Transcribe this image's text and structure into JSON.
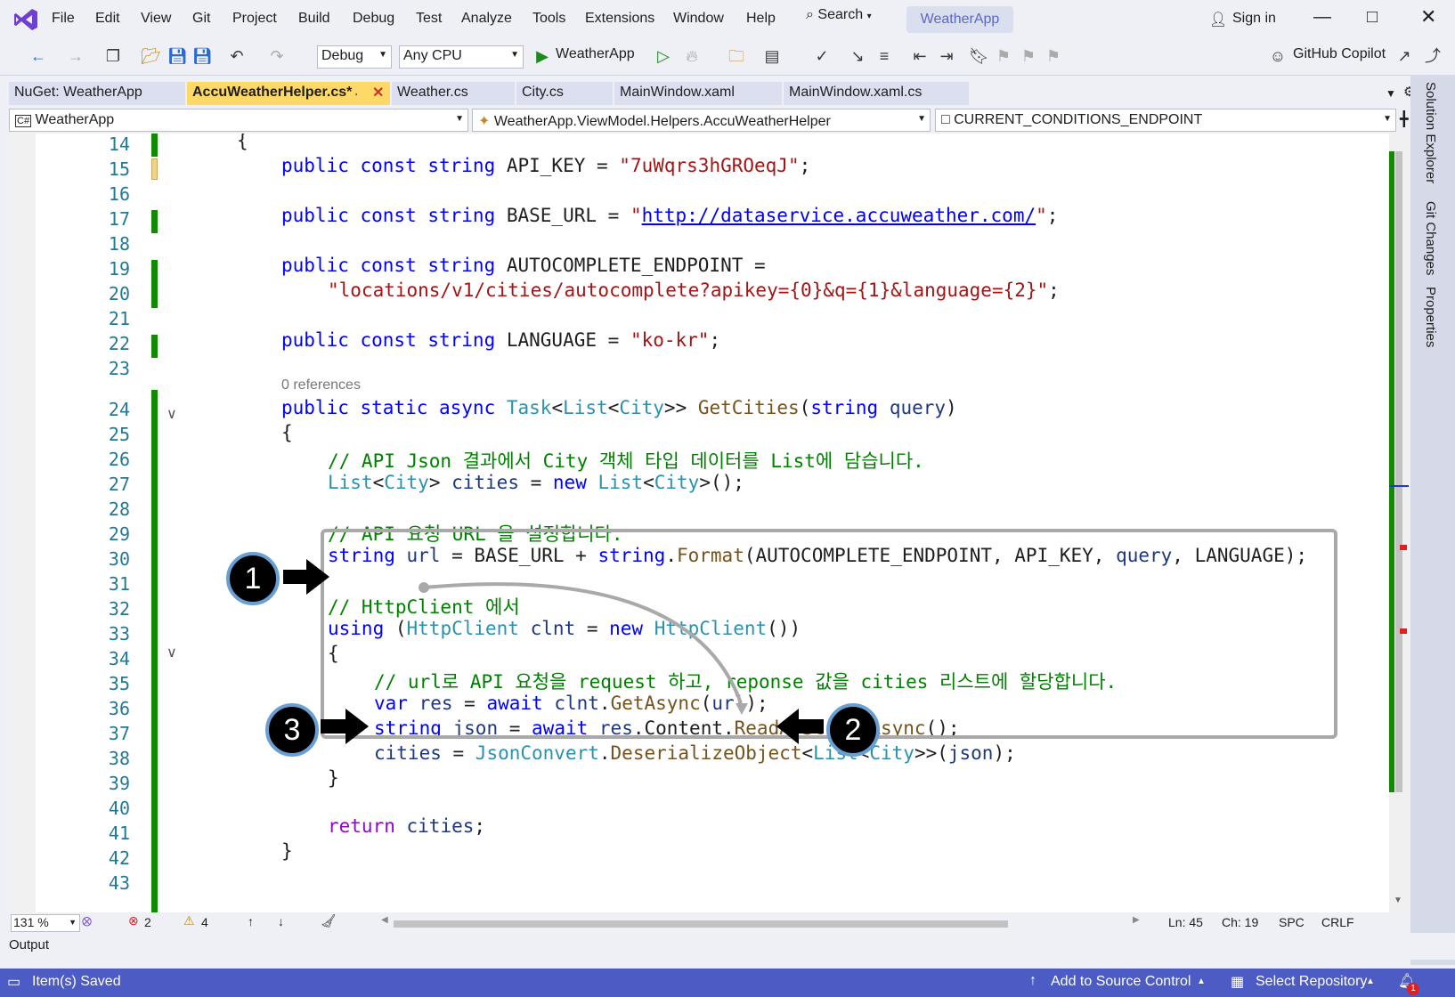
{
  "menu": [
    "File",
    "Edit",
    "View",
    "Git",
    "Project",
    "Build",
    "Debug",
    "Test",
    "Analyze",
    "Tools",
    "Extensions",
    "Window",
    "Help"
  ],
  "search_label": "Search",
  "project_name": "WeatherApp",
  "sign_in": "Sign in",
  "toolbar": {
    "config": "Debug",
    "platform": "Any CPU",
    "run_target": "WeatherApp",
    "copilot": "GitHub Copilot"
  },
  "tabs": [
    {
      "label": "NuGet: WeatherApp"
    },
    {
      "label": "AccuWeatherHelper.cs*"
    },
    {
      "label": "Weather.cs"
    },
    {
      "label": "City.cs"
    },
    {
      "label": "MainWindow.xaml"
    },
    {
      "label": "MainWindow.xaml.cs"
    }
  ],
  "nav": {
    "project": "WeatherApp",
    "class": "WeatherApp.ViewModel.Helpers.AccuWeatherHelper",
    "member": "CURRENT_CONDITIONS_ENDPOINT"
  },
  "line_numbers": [
    "14",
    "15",
    "16",
    "17",
    "18",
    "19",
    "20",
    "21",
    "22",
    "23",
    "24",
    "25",
    "26",
    "27",
    "28",
    "29",
    "30",
    "31",
    "32",
    "33",
    "34",
    "35",
    "36",
    "37",
    "38",
    "39",
    "40",
    "41",
    "42",
    "43"
  ],
  "code": {
    "api_key_value": "\"7uWqrs3hGROeqJ\"",
    "base_url_value": "http://dataservice.accuweather.com/",
    "autocomplete_value": "\"locations/v1/cities/autocomplete?apikey={0}&q={1}&language={2}\"",
    "language_value": "\"ko-kr\"",
    "references": "0 references",
    "comment1": "// API Json 결과에서 City 객체 타입 데이터를 List에 담습니다.",
    "comment2": "// API 요청 URL 을 설정합니다.",
    "comment3": "// HttpClient 에서",
    "comment4": "// url로 API 요청을 request 하고, reponse 값을 cities 리스트에 할당합니다."
  },
  "annotations": [
    "1",
    "2",
    "3"
  ],
  "side_panel": [
    "Solution Explorer",
    "Git Changes",
    "Properties"
  ],
  "editor_status": {
    "zoom": "131 %",
    "errors": "2",
    "warnings": "4",
    "line": "Ln: 45",
    "col": "Ch: 19",
    "spacing": "SPC",
    "eol": "CRLF"
  },
  "output_label": "Output",
  "statusbar": {
    "saved": "Item(s) Saved",
    "source_control": "Add to Source Control",
    "repository": "Select Repository",
    "notifications": "1"
  },
  "colors": {
    "accent": "#4c5cc4",
    "active_tab": "#ffd967",
    "change_bar": "#108a00"
  }
}
